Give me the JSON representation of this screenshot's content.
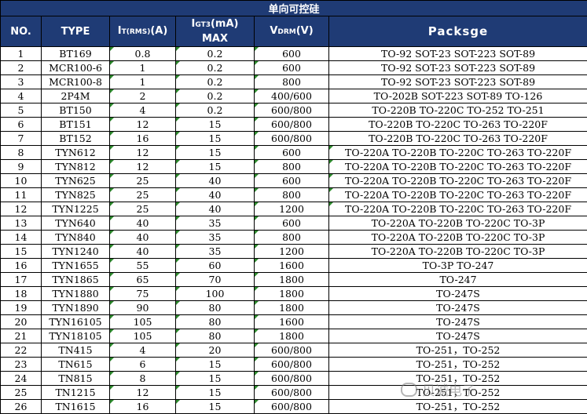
{
  "title": "单向可控硅",
  "headers": {
    "no": "NO.",
    "type": "TYPE",
    "it": {
      "main": "I",
      "sub": "T(RMS)",
      "unit": "(A)"
    },
    "igt": {
      "main": "I",
      "sub": "GT3",
      "unit": "(mA)",
      "line2": "MAX"
    },
    "vdrm": {
      "main": "V",
      "sub": "DRM",
      "unit": "(V)"
    },
    "package": "Packsge"
  },
  "rows": [
    {
      "no": "1",
      "type": "BT169",
      "it": "0.8",
      "igt": "0.2",
      "vdrm": "600",
      "pkg": "TO-92 SOT-23 SOT-223 SOT-89"
    },
    {
      "no": "2",
      "type": "MCR100-6",
      "it": "1",
      "igt": "0.2",
      "vdrm": "600",
      "pkg": "TO-92 SOT-23 SOT-223 SOT-89"
    },
    {
      "no": "3",
      "type": "MCR100-8",
      "it": "1",
      "igt": "0.2",
      "vdrm": "800",
      "pkg": "TO-92 SOT-23 SOT-223 SOT-89"
    },
    {
      "no": "4",
      "type": "2P4M",
      "it": "2",
      "igt": "0.2",
      "vdrm": "400/600",
      "pkg": "TO-202B SOT-223 SOT-89 TO-126"
    },
    {
      "no": "5",
      "type": "BT150",
      "it": "4",
      "igt": "0.2",
      "vdrm": "600/800",
      "pkg": "TO-220B TO-220C TO-252 TO-251"
    },
    {
      "no": "6",
      "type": "BT151",
      "it": "12",
      "igt": "15",
      "vdrm": "600/800",
      "pkg": "TO-220B TO-220C TO-263 TO-220F"
    },
    {
      "no": "7",
      "type": "BT152",
      "it": "16",
      "igt": "15",
      "vdrm": "600/800",
      "pkg": "TO-220B TO-220C TO-263 TO-220F"
    },
    {
      "no": "8",
      "type": "TYN612",
      "it": "12",
      "igt": "15",
      "vdrm": "600",
      "pkg": "TO-220A TO-220B TO-220C TO-263 TO-220F"
    },
    {
      "no": "9",
      "type": "TYN812",
      "it": "12",
      "igt": "15",
      "vdrm": "800",
      "pkg": "TO-220A TO-220B TO-220C TO-263 TO-220F"
    },
    {
      "no": "10",
      "type": "TYN625",
      "it": "25",
      "igt": "40",
      "vdrm": "600",
      "pkg": "TO-220A TO-220B TO-220C TO-263 TO-220F"
    },
    {
      "no": "11",
      "type": "TYN825",
      "it": "25",
      "igt": "40",
      "vdrm": "800",
      "pkg": "TO-220A TO-220B TO-220C TO-263 TO-220F"
    },
    {
      "no": "12",
      "type": "TYN1225",
      "it": "25",
      "igt": "40",
      "vdrm": "1200",
      "pkg": "TO-220A TO-220B TO-220C TO-263 TO-220F"
    },
    {
      "no": "13",
      "type": "TYN640",
      "it": "40",
      "igt": "35",
      "vdrm": "600",
      "pkg": "TO-220A TO-220B TO-220C TO-3P"
    },
    {
      "no": "14",
      "type": "TYN840",
      "it": "40",
      "igt": "35",
      "vdrm": "800",
      "pkg": "TO-220A TO-220B TO-220C TO-3P"
    },
    {
      "no": "15",
      "type": "TYN1240",
      "it": "40",
      "igt": "35",
      "vdrm": "1200",
      "pkg": "TO-220A TO-220B TO-220C TO-3P"
    },
    {
      "no": "16",
      "type": "TYN1655",
      "it": "55",
      "igt": "60",
      "vdrm": "1600",
      "pkg": "TO-3P TO-247"
    },
    {
      "no": "17",
      "type": "TYN1865",
      "it": "65",
      "igt": "70",
      "vdrm": "1800",
      "pkg": "TO-247"
    },
    {
      "no": "18",
      "type": "TYN1880",
      "it": "75",
      "igt": "100",
      "vdrm": "1800",
      "pkg": "TO-247S"
    },
    {
      "no": "19",
      "type": "TYN1890",
      "it": "90",
      "igt": "80",
      "vdrm": "1800",
      "pkg": "TO-247S"
    },
    {
      "no": "20",
      "type": "TYN16105",
      "it": "105",
      "igt": "80",
      "vdrm": "1600",
      "pkg": "TO-247S"
    },
    {
      "no": "21",
      "type": "TYN18105",
      "it": "105",
      "igt": "80",
      "vdrm": "1800",
      "pkg": "TO-247S"
    },
    {
      "no": "22",
      "type": "TN415",
      "it": "4",
      "igt": "20",
      "vdrm": "600/800",
      "pkg": "TO-251，TO-252"
    },
    {
      "no": "23",
      "type": "TN615",
      "it": "6",
      "igt": "15",
      "vdrm": "600/800",
      "pkg": "TO-251，TO-252"
    },
    {
      "no": "24",
      "type": "TN815",
      "it": "8",
      "igt": "15",
      "vdrm": "600/800",
      "pkg": "TO-251，TO-252"
    },
    {
      "no": "25",
      "type": "TN1215",
      "it": "12",
      "igt": "15",
      "vdrm": "600/800",
      "pkg": "TO-251，TO-252"
    },
    {
      "no": "26",
      "type": "TN1615",
      "it": "16",
      "igt": "15",
      "vdrm": "600/800",
      "pkg": "TO-251，TO-252"
    }
  ],
  "watermark": "贝诚电子",
  "colors": {
    "header_bg": "#1f3b75",
    "header_text": "#ffffff",
    "flag": "#2e8b2e"
  }
}
